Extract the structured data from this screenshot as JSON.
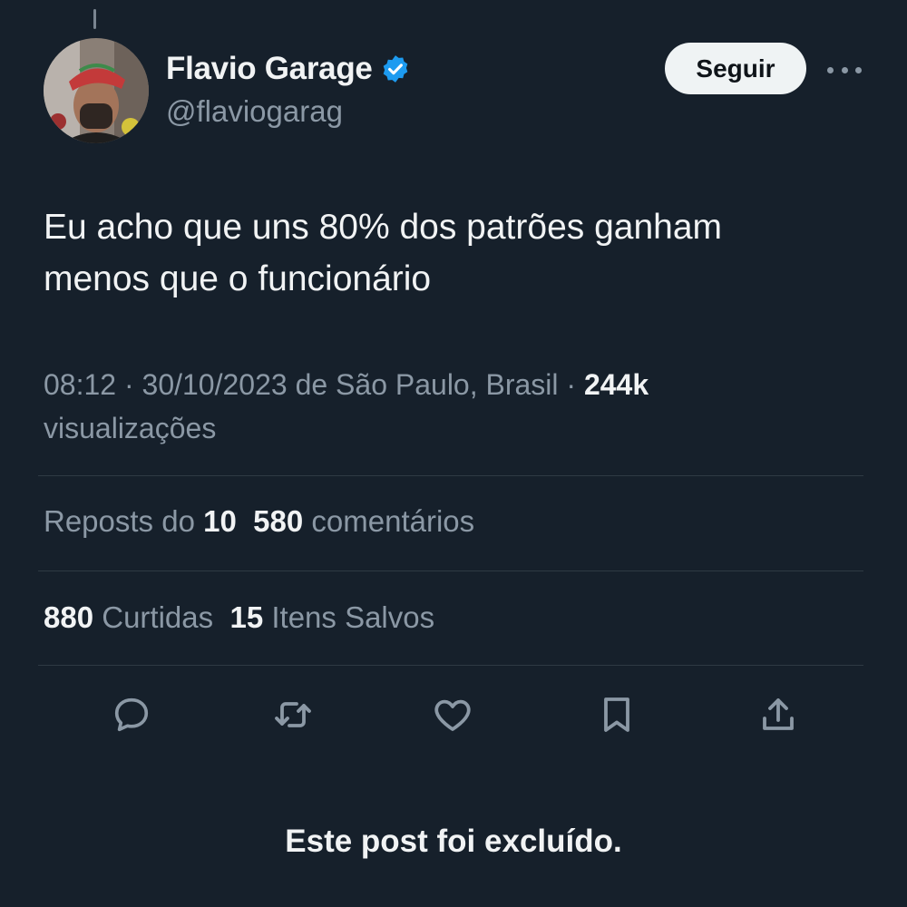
{
  "author": {
    "display_name": "Flavio Garage",
    "handle": "@flaviogarag",
    "verified_icon": "verified-badge-icon",
    "avatar_icon": "avatar-photo"
  },
  "header": {
    "follow_label": "Seguir",
    "more_icon": "more-options-icon"
  },
  "tweet": {
    "text_line1": "Eu acho que uns 80% dos patrões ganham",
    "text_line2": "menos que o funcionário",
    "time": "08:12",
    "separator": " · ",
    "date": "30/10/2023",
    "location": " de São Paulo, Brasil",
    "views_count": "244k",
    "views_label": "visualizações"
  },
  "stats": {
    "reposts_label": "Reposts do ",
    "reposts_count": "10",
    "comments_count": "580",
    "comments_label": " comentários",
    "likes_count": "880",
    "likes_label": " Curtidas",
    "saves_count": "15",
    "saves_label": " Itens Salvos"
  },
  "actions": [
    "reply-icon",
    "repost-icon",
    "like-icon",
    "bookmark-icon",
    "share-icon"
  ],
  "footer": {
    "deleted_notice": "Este post foi excluído."
  },
  "colors": {
    "background": "#16202b",
    "accent": "#1d9bf0",
    "muted_text": "#8b98a5",
    "primary_text": "#f1f3f4"
  }
}
